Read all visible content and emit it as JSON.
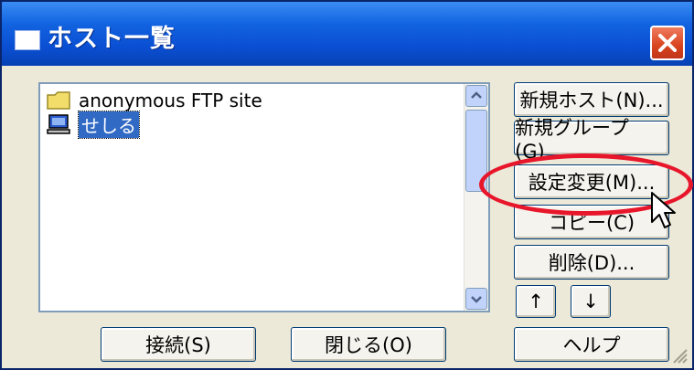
{
  "window": {
    "title": "ホスト一覧"
  },
  "list": {
    "items": [
      {
        "label": "anonymous FTP site",
        "icon": "folder-icon",
        "selected": false
      },
      {
        "label": "せしる",
        "icon": "computer-icon",
        "selected": true
      }
    ]
  },
  "buttons": {
    "new_host": "新規ホスト(N)...",
    "new_group": "新規グループ(G)...",
    "modify": "設定変更(M)...",
    "copy": "コピー(C)",
    "delete": "削除(D)...",
    "move_up": "↑",
    "move_down": "↓",
    "help": "ヘルプ",
    "connect": "接続(S)",
    "close": "閉じる(O)"
  },
  "colors": {
    "titlebar": "#0a4fd3",
    "highlight": "#e8162a",
    "selection": "#316ac5"
  }
}
